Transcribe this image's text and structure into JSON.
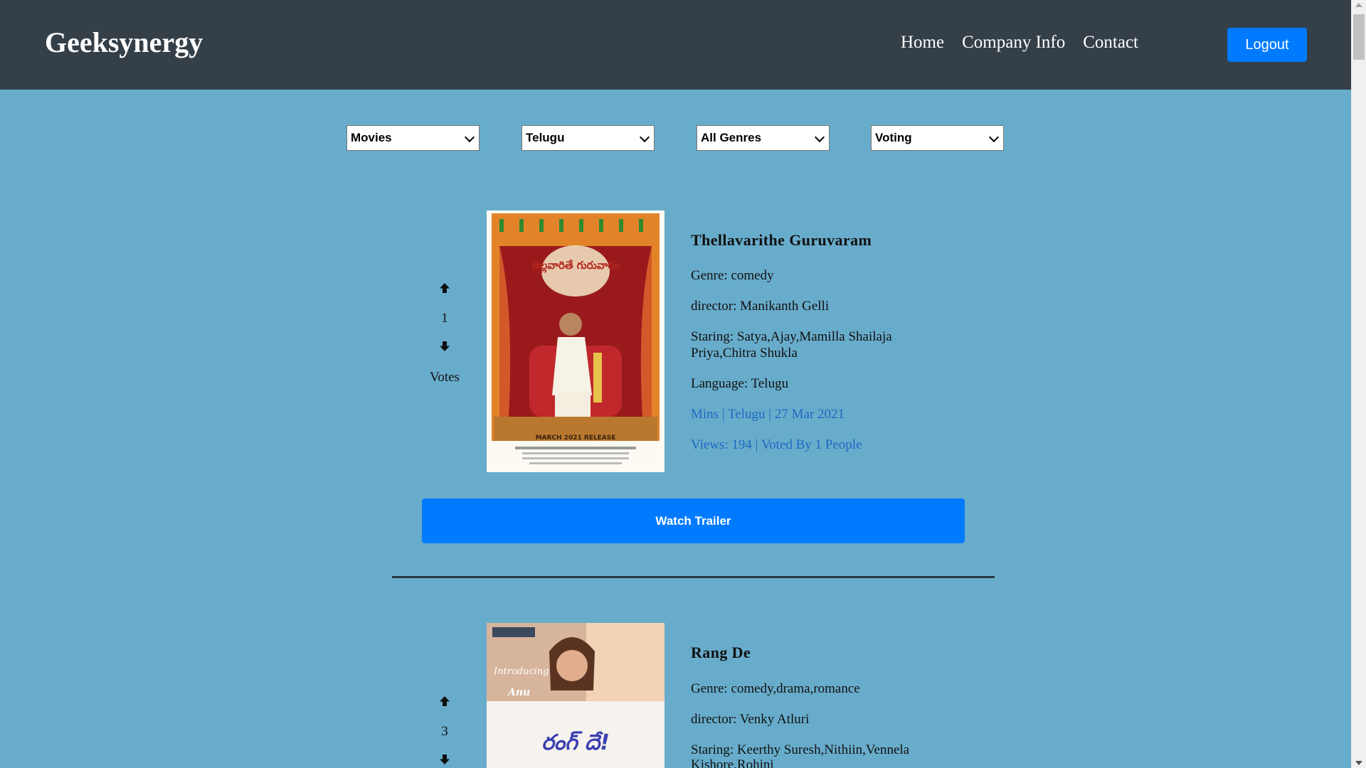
{
  "header": {
    "brand": "Geeksynergy",
    "nav": [
      "Home",
      "Company Info",
      "Contact"
    ],
    "logout_label": "Logout"
  },
  "filters": {
    "category": "Movies",
    "language": "Telugu",
    "genre": "All Genres",
    "sort": "Voting"
  },
  "movies": [
    {
      "title": "Thellavarithe Guruvaram",
      "votes": "1",
      "votes_label": "Votes",
      "genre": "Genre: comedy",
      "director": "director: Manikanth Gelli",
      "staring_line1": "Staring: Satya,Ajay,Mamilla Shailaja",
      "staring_line2": "Priya,Chitra Shukla",
      "language": "Language: Telugu",
      "meta": "Mins | Telugu | 27 Mar 2021",
      "views": "Views: 194 | Voted By 1 People",
      "poster_title": "తెల్లవారితే గురువారం",
      "poster_release": "MARCH 2021 RELEASE",
      "trailer_label": "Watch Trailer"
    },
    {
      "title": "Rang De",
      "votes": "3",
      "genre": "Genre: comedy,drama,romance",
      "director": "director: Venky Atluri",
      "staring_line1": "Staring: Keerthy Suresh,Nithiin,Vennela",
      "staring_line2": "Kishore,Rohini",
      "poster_title": "రంగ్ దే!",
      "poster_tag1": "Introducing",
      "poster_tag2": "Anu"
    }
  ],
  "colors": {
    "navbar": "#343f48",
    "page_bg": "#68accb",
    "primary": "#007bff",
    "link_blue": "#1c69c3"
  },
  "icons": {
    "vote_up": "arrow-up-icon",
    "vote_down": "arrow-down-icon",
    "dropdown": "chevron-down-icon"
  }
}
